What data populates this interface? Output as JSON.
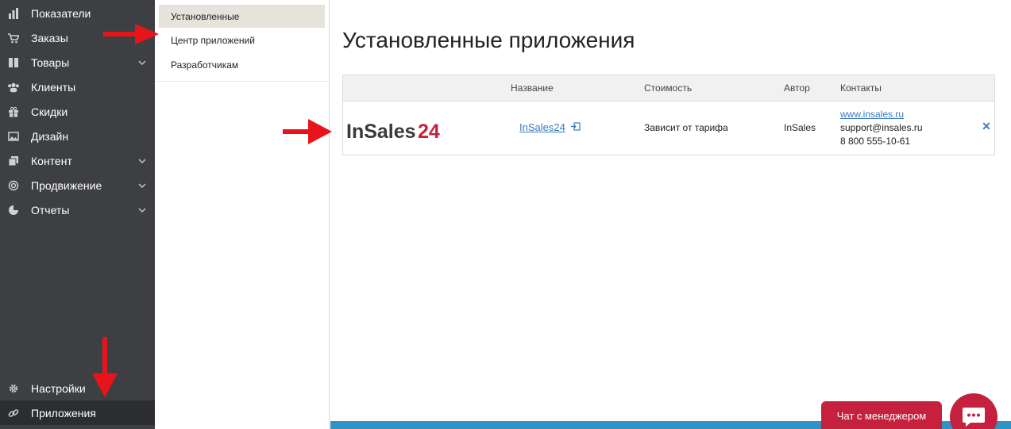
{
  "nav": {
    "items": [
      {
        "label": "Показатели",
        "icon": "bar-chart-icon",
        "chevron": false
      },
      {
        "label": "Заказы",
        "icon": "cart-icon",
        "chevron": false
      },
      {
        "label": "Товары",
        "icon": "box-icon",
        "chevron": true
      },
      {
        "label": "Клиенты",
        "icon": "users-icon",
        "chevron": false
      },
      {
        "label": "Скидки",
        "icon": "gift-icon",
        "chevron": false
      },
      {
        "label": "Дизайн",
        "icon": "image-icon",
        "chevron": false
      },
      {
        "label": "Контент",
        "icon": "pages-icon",
        "chevron": true
      },
      {
        "label": "Продвижение",
        "icon": "target-icon",
        "chevron": true
      },
      {
        "label": "Отчеты",
        "icon": "pie-chart-icon",
        "chevron": true
      }
    ],
    "bottom": [
      {
        "label": "Настройки",
        "icon": "gear-icon"
      },
      {
        "label": "Приложения",
        "icon": "link-icon"
      }
    ]
  },
  "subnav": {
    "items": [
      "Установленные",
      "Центр приложений",
      "Разработчикам"
    ],
    "active": "Установленные"
  },
  "main": {
    "title": "Установленные приложения",
    "columns": [
      "Название",
      "Стоимость",
      "Автор",
      "Контакты"
    ],
    "apps": [
      {
        "logo_text_1": "InSales",
        "logo_text_2": "24",
        "name": "InSales24",
        "cost": "Зависит от тарифа",
        "author": "InSales",
        "site": "www.insales.ru",
        "email": "support@insales.ru",
        "phone": "8 800 555-10-61"
      }
    ]
  },
  "chat": {
    "label": "Чат с менеджером"
  },
  "colors": {
    "nav_bg": "#3d3f42",
    "accent": "#c5213e",
    "link": "#3a7bbf",
    "bar": "#2f93c4",
    "arrow": "#e8141b"
  }
}
